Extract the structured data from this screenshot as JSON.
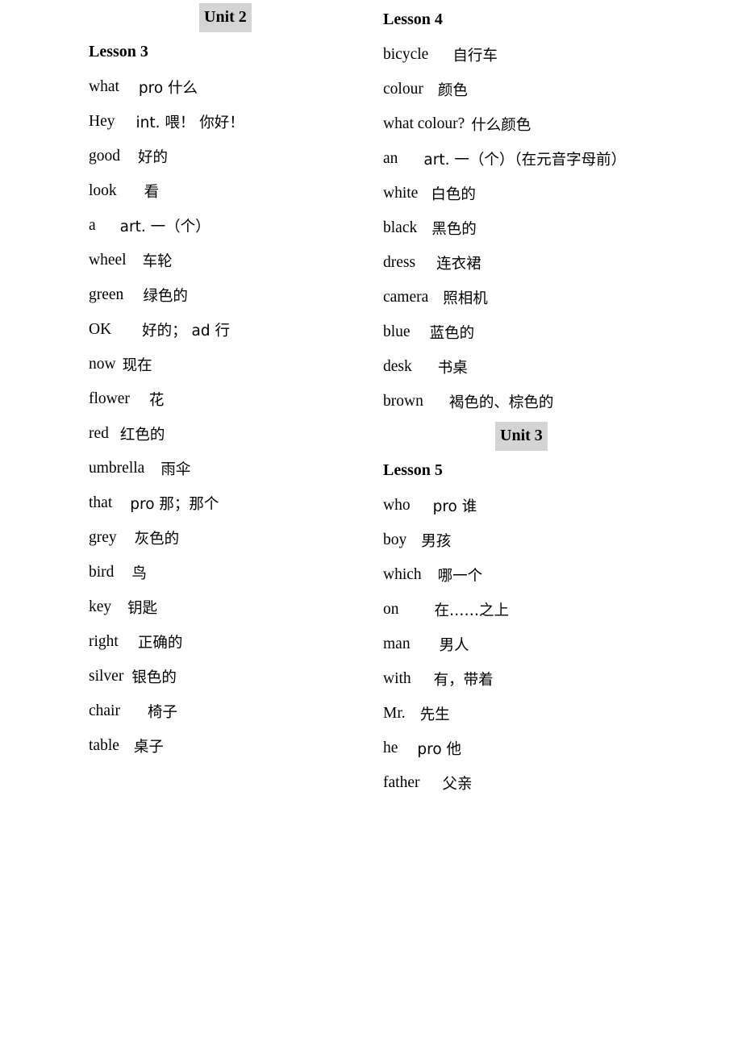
{
  "document": {
    "title": "Unit 2 / Unit 3 English-Chinese Vocabulary List",
    "highlight_color": "#d4d4d4",
    "text_color": "#000000",
    "background_color": "#ffffff"
  },
  "left_column": {
    "unit": {
      "label": "Unit 2"
    },
    "lesson": {
      "label": "Lesson 3"
    },
    "entries": [
      {
        "en": "what",
        "gap": 24,
        "zh": "pro 什么"
      },
      {
        "en": "Hey",
        "gap": 26,
        "zh": "int. 喂！ 你好！"
      },
      {
        "en": "good",
        "gap": 22,
        "zh": "好的"
      },
      {
        "en": "look",
        "gap": 34,
        "zh": "看"
      },
      {
        "en": "a",
        "gap": 30,
        "zh": "art. 一（个）"
      },
      {
        "en": "wheel",
        "gap": 20,
        "zh": "车轮"
      },
      {
        "en": "green",
        "gap": 24,
        "zh": "绿色的"
      },
      {
        "en": "OK",
        "gap": 38,
        "zh": "好的； ad 行"
      },
      {
        "en": "now",
        "gap": 8,
        "zh": "现在"
      },
      {
        "en": "flower",
        "gap": 24,
        "zh": "花"
      },
      {
        "en": "red",
        "gap": 14,
        "zh": "红色的"
      },
      {
        "en": "umbrella",
        "gap": 20,
        "zh": "雨伞"
      },
      {
        "en": "that",
        "gap": 22,
        "zh": "pro 那；那个"
      },
      {
        "en": "grey",
        "gap": 22,
        "zh": "灰色的"
      },
      {
        "en": "bird",
        "gap": 22,
        "zh": "鸟"
      },
      {
        "en": "key",
        "gap": 20,
        "zh": "钥匙"
      },
      {
        "en": "right",
        "gap": 24,
        "zh": "正确的"
      },
      {
        "en": "silver",
        "gap": 10,
        "zh": "银色的"
      },
      {
        "en": "chair",
        "gap": 34,
        "zh": "椅子"
      },
      {
        "en": "table",
        "gap": 18,
        "zh": "桌子"
      }
    ]
  },
  "right_column": {
    "lesson_4": {
      "label": "Lesson 4",
      "entries": [
        {
          "en": "bicycle",
          "gap": 30,
          "zh": "自行车"
        },
        {
          "en": "colour",
          "gap": 18,
          "zh": "颜色"
        },
        {
          "en": "what colour?",
          "gap": 8,
          "zh": "什么颜色"
        },
        {
          "en": "an",
          "gap": 32,
          "zh": "art. 一（个）（在元音字母前）"
        },
        {
          "en": "white",
          "gap": 16,
          "zh": "白色的"
        },
        {
          "en": "black",
          "gap": 18,
          "zh": "黑色的"
        },
        {
          "en": "dress",
          "gap": 26,
          "zh": "连衣裙"
        },
        {
          "en": "camera",
          "gap": 18,
          "zh": "照相机"
        },
        {
          "en": "blue",
          "gap": 24,
          "zh": "蓝色的"
        },
        {
          "en": "desk",
          "gap": 32,
          "zh": "书桌"
        },
        {
          "en": "brown",
          "gap": 32,
          "zh": "褐色的、棕色的"
        }
      ]
    },
    "unit": {
      "label": "Unit 3"
    },
    "lesson_5": {
      "label": "Lesson 5",
      "entries": [
        {
          "en": "who",
          "gap": 28,
          "zh": "pro 谁"
        },
        {
          "en": "boy",
          "gap": 18,
          "zh": "男孩"
        },
        {
          "en": "which",
          "gap": 20,
          "zh": "哪一个"
        },
        {
          "en": "on",
          "gap": 44,
          "zh": "在……之上"
        },
        {
          "en": "man",
          "gap": 36,
          "zh": "男人"
        },
        {
          "en": "with",
          "gap": 28,
          "zh": "有，带着"
        },
        {
          "en": "Mr.",
          "gap": 18,
          "zh": "先生"
        },
        {
          "en": "he",
          "gap": 24,
          "zh": "pro 他"
        },
        {
          "en": "father",
          "gap": 28,
          "zh": "父亲"
        }
      ]
    }
  }
}
